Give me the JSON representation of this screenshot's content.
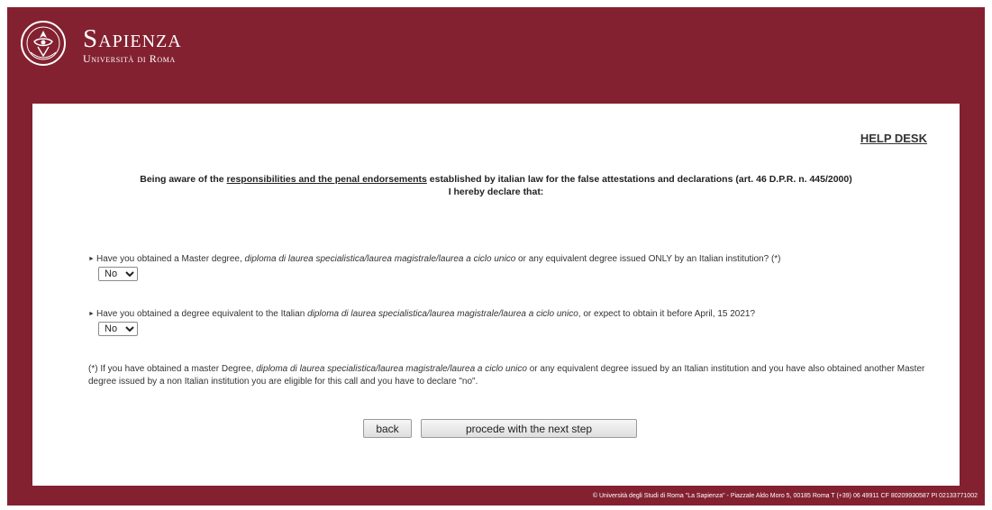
{
  "colors": {
    "brand": "#832131",
    "panel": "#ffffff",
    "text": "#222222"
  },
  "header": {
    "brand_name": "Sapienza",
    "brand_sub": "Università di Roma",
    "seal_icon": "university-seal-icon"
  },
  "helpdesk": {
    "label": "HELP DESK"
  },
  "declaration": {
    "prefix": "Being aware of the ",
    "link": "responsibilities and the penal endorsements",
    "suffix": " established by italian law for the false attestations and declarations (art. 46 D.P.R. n. 445/2000)",
    "line2": "I hereby declare that:"
  },
  "questions": [
    {
      "before": "Have you obtained a Master degree, ",
      "italic": "diploma di laurea specialistica/laurea magistrale/laurea a ciclo unico",
      "after": " or any equivalent degree issued ONLY by an Italian institution? (*)",
      "answer": "No",
      "options": [
        "No"
      ]
    },
    {
      "before": "Have you obtained a degree equivalent to the Italian ",
      "italic": "diploma di laurea specialistica/laurea magistrale/laurea a ciclo unico",
      "after": ", or expect to obtain it before April, 15 2021?",
      "answer": "No",
      "options": [
        "No"
      ]
    }
  ],
  "note": {
    "before": "(*) If you have obtained a master Degree, ",
    "italic": "diploma di laurea specialistica/laurea magistrale/laurea a ciclo unico",
    "after": " or any equivalent degree issued by an Italian institution and you have also obtained another Master degree issued by a non Italian institution you are eligible for this call and you have to declare \"no\"."
  },
  "buttons": {
    "back": "back",
    "next": "procede with the next step"
  },
  "footer": {
    "text": "© Università degli Studi di Roma \"La Sapienza\" - Piazzale Aldo Moro 5, 00185 Roma T (+39) 06 49911 CF 80209930587 PI 02133771002"
  }
}
